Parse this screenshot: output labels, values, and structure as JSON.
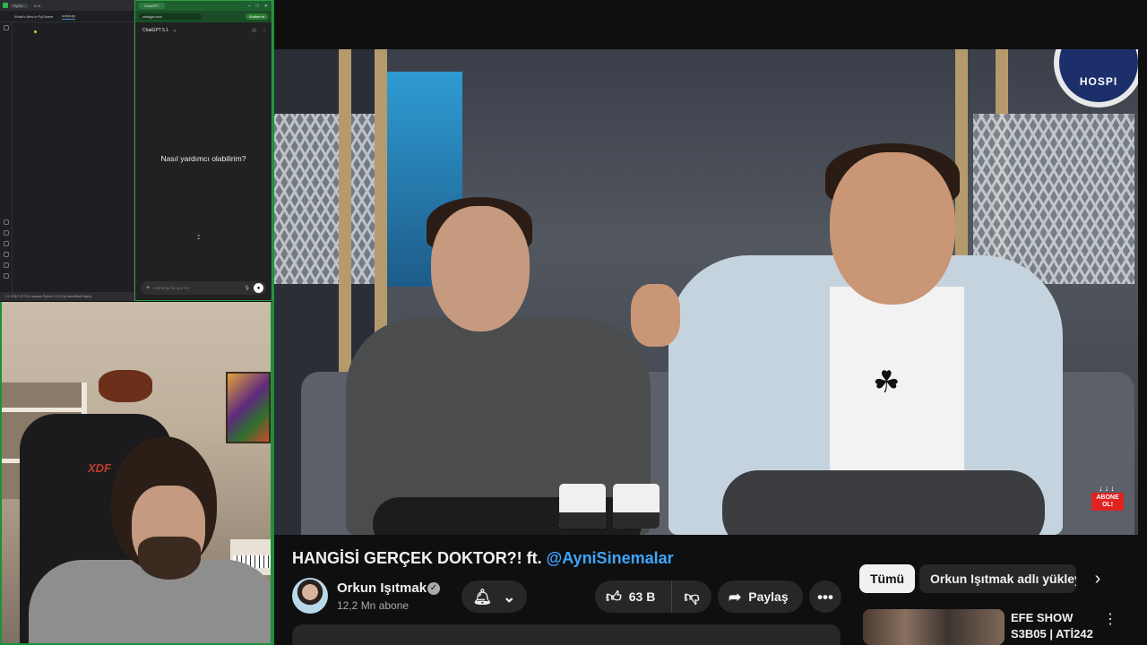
{
  "pycharm": {
    "window_tabs": [
      "PyCh...",
      "Yo b..."
    ],
    "editor_tabs": [
      "What's New in PyCharm",
      "script.py"
    ],
    "status": "1:1  CRLF  UTF-8  4 spaces  Python 3.11 (PyCharmMiscProject)"
  },
  "chatgpt": {
    "browser_tab": "ChatGPT",
    "url": "chatgpt.com",
    "action_label": "Sohbet et",
    "model": "ChatGPT 5.1",
    "greeting": "Nasıl yardımcı olabilirim?",
    "composer_placeholder": "Herhangi bir şey sor"
  },
  "webcam": {
    "chair_brand": "XDF"
  },
  "video": {
    "channel_watermark": "HOSPI",
    "subscribe_badge": "ABONE OL!",
    "subscribe_arrows": "↓↓↓",
    "title_text": "HANGİSİ GERÇEK DOKTOR?! ft. ",
    "title_mention": "@AyniSinemalar",
    "channel_name": "Orkun Işıtmak",
    "subscribers": "12,2 Mn abone",
    "likes": "63 B",
    "share_label": "Paylaş"
  },
  "sidebar": {
    "chip_all": "Tümü",
    "chip_uploads": "Orkun Işıtmak adlı yükleyici",
    "rec_title": "EFE SHOW S3B05 | ATİ242"
  },
  "colors": {
    "accent_green": "#1f8f3a",
    "mention_blue": "#3ea6ff",
    "subscribe_red": "#e02222"
  }
}
